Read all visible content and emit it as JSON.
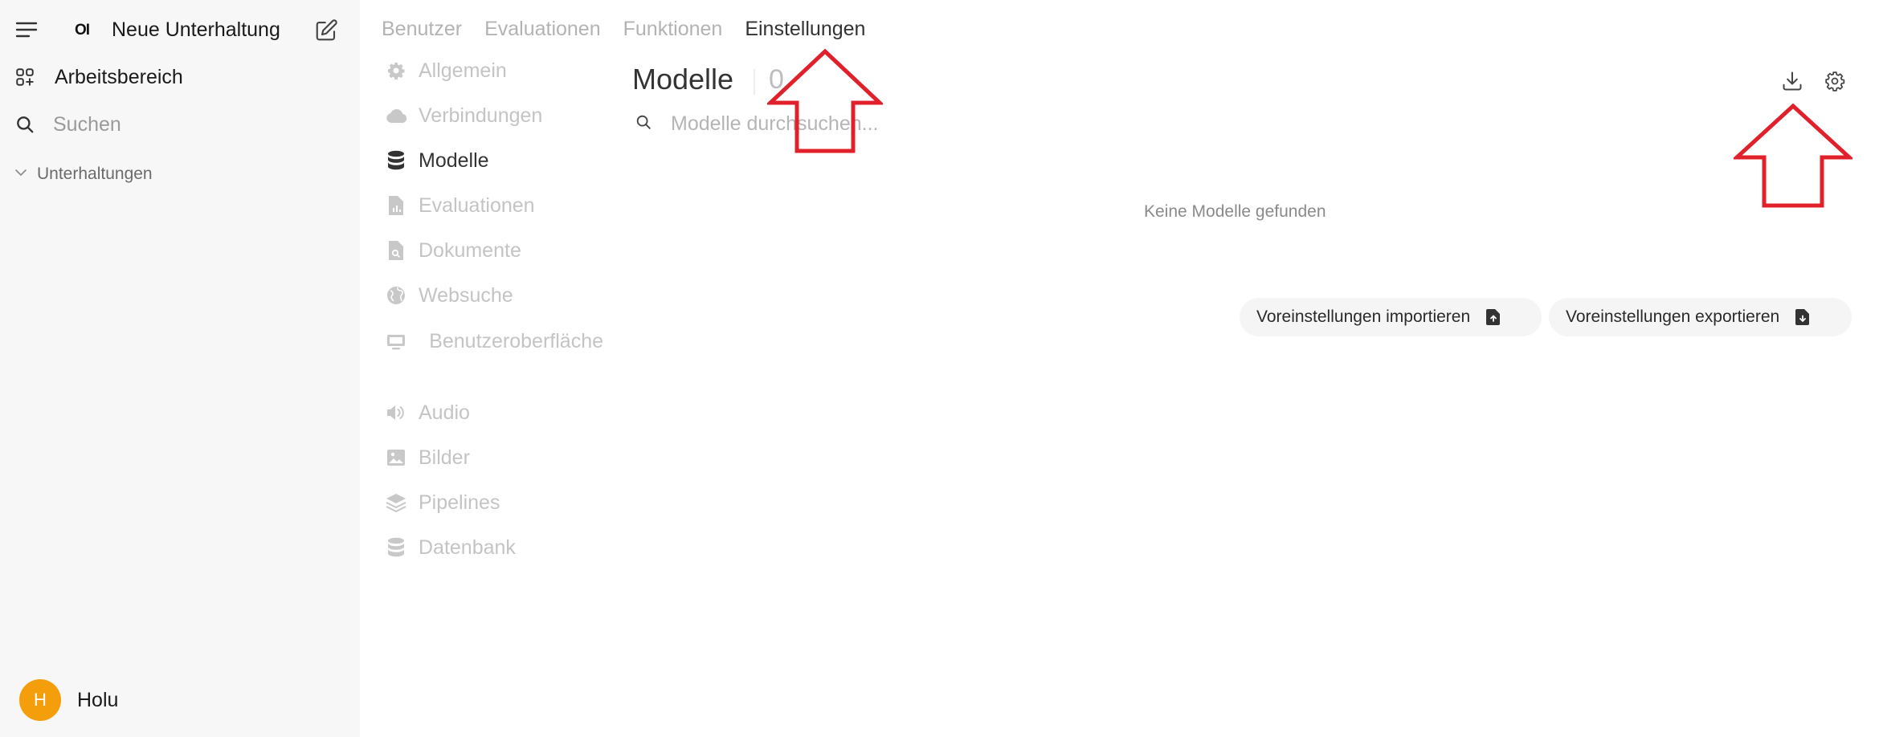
{
  "sidebar": {
    "new_chat_label": "Neue Unterhaltung",
    "logo_text": "OI",
    "workspace_label": "Arbeitsbereich",
    "search_label": "Suchen",
    "chats_label": "Unterhaltungen",
    "user": {
      "initial": "H",
      "name": "Holu"
    }
  },
  "tabs": [
    {
      "label": "Benutzer",
      "active": false
    },
    {
      "label": "Evaluationen",
      "active": false
    },
    {
      "label": "Funktionen",
      "active": false
    },
    {
      "label": "Einstellungen",
      "active": true
    }
  ],
  "settings_nav": [
    {
      "label": "Allgemein",
      "icon": "gear-icon",
      "active": false
    },
    {
      "label": "Verbindungen",
      "icon": "cloud-icon",
      "active": false
    },
    {
      "label": "Modelle",
      "icon": "database-icon",
      "active": true
    },
    {
      "label": "Evaluationen",
      "icon": "document-chart-icon",
      "active": false
    },
    {
      "label": "Dokumente",
      "icon": "document-search-icon",
      "active": false
    },
    {
      "label": "Websuche",
      "icon": "globe-icon",
      "active": false
    },
    {
      "label": "Benutzeroberfläche",
      "icon": "monitor-icon",
      "active": false
    },
    {
      "label": "Audio",
      "icon": "speaker-icon",
      "active": false
    },
    {
      "label": "Bilder",
      "icon": "image-icon",
      "active": false
    },
    {
      "label": "Pipelines",
      "icon": "layers-icon",
      "active": false
    },
    {
      "label": "Datenbank",
      "icon": "database-icon",
      "active": false
    }
  ],
  "main": {
    "title": "Modelle",
    "count": "0",
    "search_placeholder": "Modelle durchsuchen...",
    "empty_text": "Keine Modelle gefunden",
    "import_label": "Voreinstellungen importieren",
    "export_label": "Voreinstellungen exportieren"
  },
  "colors": {
    "sidebar_bg": "#f7f7f7",
    "avatar": "#f59e0b",
    "annotation_arrow": "#e0202a"
  }
}
